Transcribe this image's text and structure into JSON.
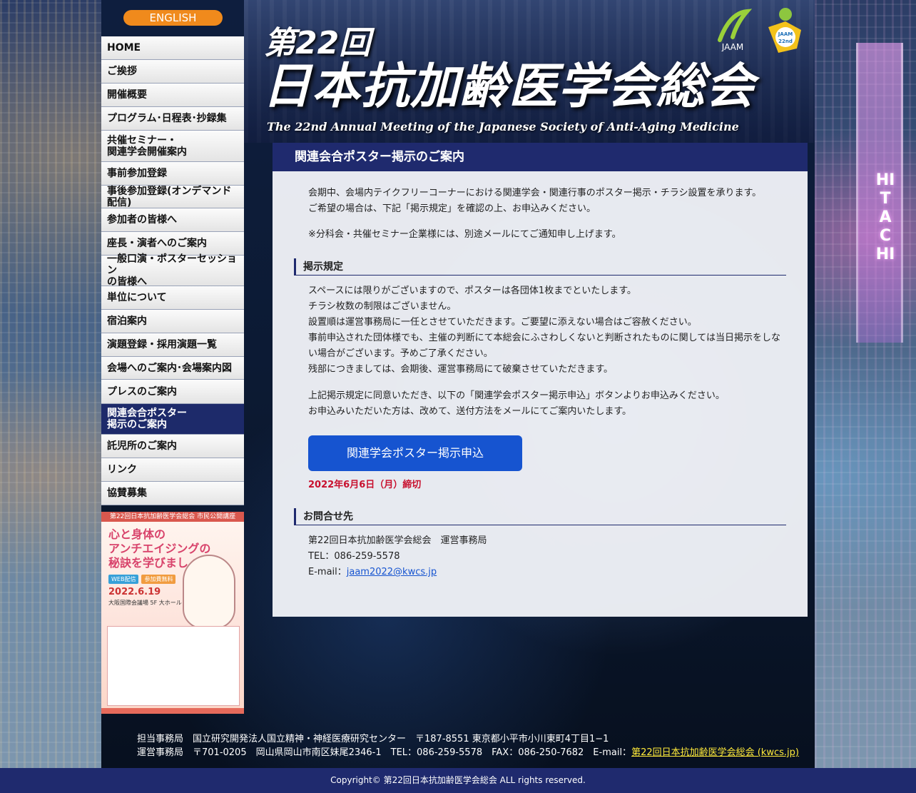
{
  "sidebar": {
    "english_label": "ENGLISH",
    "menu": [
      {
        "label": "HOME"
      },
      {
        "label": "ご挨拶"
      },
      {
        "label": "開催概要"
      },
      {
        "label": "プログラム･日程表･抄録集"
      },
      {
        "label": "共催セミナー・\n関連学会開催案内"
      },
      {
        "label": "事前参加登録"
      },
      {
        "label": "事後参加登録(オンデマンド配信)"
      },
      {
        "label": "参加者の皆様へ"
      },
      {
        "label": "座長・演者へのご案内"
      },
      {
        "label": "一般口演・ポスターセッション\nの皆様へ"
      },
      {
        "label": "単位について"
      },
      {
        "label": "宿泊案内"
      },
      {
        "label": "演題登録・採用演題一覧"
      },
      {
        "label": "会場へのご案内･会場案内図"
      },
      {
        "label": "プレスのご案内"
      },
      {
        "label": "関連会合ポスター\n掲示のご案内",
        "active": true
      },
      {
        "label": "託児所のご案内"
      },
      {
        "label": "リンク"
      },
      {
        "label": "協賛募集"
      }
    ],
    "banner": {
      "top": "第22回日本抗加齢医学会総会 市民公開講座",
      "title": "心と身体の\nアンチエイジングの\n秘訣を学びましょ",
      "tag1": "WEB配信",
      "tag2": "参加費無料",
      "date": "2022.6.19",
      "place": "大阪国際会議場 5F 大ホール"
    }
  },
  "header": {
    "title_dai": "第22回",
    "title_main": "日本抗加齢医学会総会",
    "title_en": "The 22nd Annual Meeting of the Japanese Society of Anti-Aging Medicine",
    "logo_jaam": "JAAM",
    "logo_22": "JAAM 22nd"
  },
  "content": {
    "heading": "関連会合ポスター掲示のご案内",
    "intro": [
      "会期中、会場内テイクフリーコーナーにおける関連学会・関連行事のポスター掲示・チラシ設置を承ります。",
      "ご希望の場合は、下記「掲示規定」を確認の上、お申込みください。"
    ],
    "note": "※分科会・共催セミナー企業様には、別途メールにてご通知申し上げます。",
    "rules_heading": "掲示規定",
    "rules": [
      "スペースには限りがございますので、ポスターは各団体1枚までといたします。",
      "チラシ枚数の制限はございません。",
      "設置順は運営事務局に一任とさせていただきます。ご要望に添えない場合はご容赦ください。",
      "事前申込された団体様でも、主催の判断にて本総会にふさわしくないと判断されたものに関しては当日掲示をしな",
      "い場合がございます。予めご了承ください。",
      "残部につきましては、会期後、運営事務局にて破棄させていただきます。"
    ],
    "agree": [
      "上記掲示規定に同意いただき、以下の「関連学会ポスター掲示申込」ボタンよりお申込みください。",
      "お申込みいただいた方は、改めて、送付方法をメールにてご案内いたします。"
    ],
    "apply_button": "関連学会ポスター掲示申込",
    "deadline": "2022年6月6日（月）締切",
    "contact_heading": "お問合せ先",
    "contact_name": "第22回日本抗加齢医学会総会　運営事務局",
    "contact_tel": "TEL：086-259-5578",
    "contact_email_label": "E-mail：",
    "contact_email": "jaam2022@kwcs.jp"
  },
  "footer": {
    "line1": "担当事務局　国立研究開発法人国立精神・神経医療研究センター　〒187-8551 東京都小平市小川東町4丁目1−1",
    "line2_prefix": "運営事務局　〒701-0205　岡山県岡山市南区妹尾2346-1　TEL：086-259-5578　FAX：086-250-7682　E-mail：",
    "line2_link": "第22回日本抗加齢医学会総会 (kwcs.jp)",
    "copyright": "Copyright© 第22回日本抗加齢医学会総会 ALL rights reserved."
  },
  "background": {
    "tower_sign": "HITACHI"
  }
}
